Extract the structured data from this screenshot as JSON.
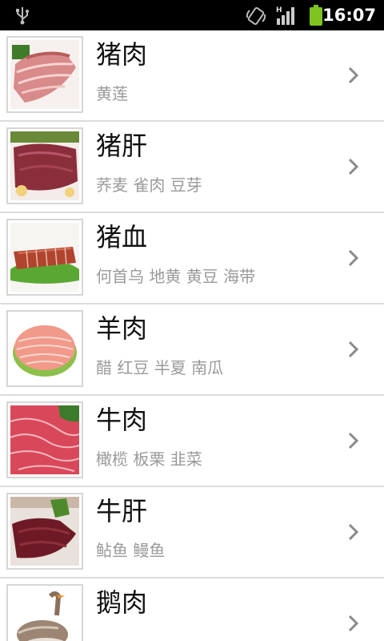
{
  "status_bar": {
    "time": "16:07",
    "icons": [
      "usb-icon",
      "rotate-icon",
      "signal-icon",
      "battery-icon"
    ],
    "signal_network": "H",
    "battery_color": "#7ec31f"
  },
  "items": [
    {
      "name": "猪肉",
      "pairings": "黄莲",
      "image": "pork-image"
    },
    {
      "name": "猪肝",
      "pairings": "荞麦 雀肉 豆芽",
      "image": "pork-liver-image"
    },
    {
      "name": "猪血",
      "pairings": "何首乌 地黄 黄豆 海带",
      "image": "pork-blood-image"
    },
    {
      "name": "羊肉",
      "pairings": "醋 红豆 半夏 南瓜",
      "image": "lamb-image"
    },
    {
      "name": "牛肉",
      "pairings": "橄榄 板栗 韭菜",
      "image": "beef-image"
    },
    {
      "name": "牛肝",
      "pairings": "鲇鱼 鳗鱼",
      "image": "beef-liver-image"
    },
    {
      "name": "鹅肉",
      "pairings": "",
      "image": "goose-image"
    }
  ]
}
